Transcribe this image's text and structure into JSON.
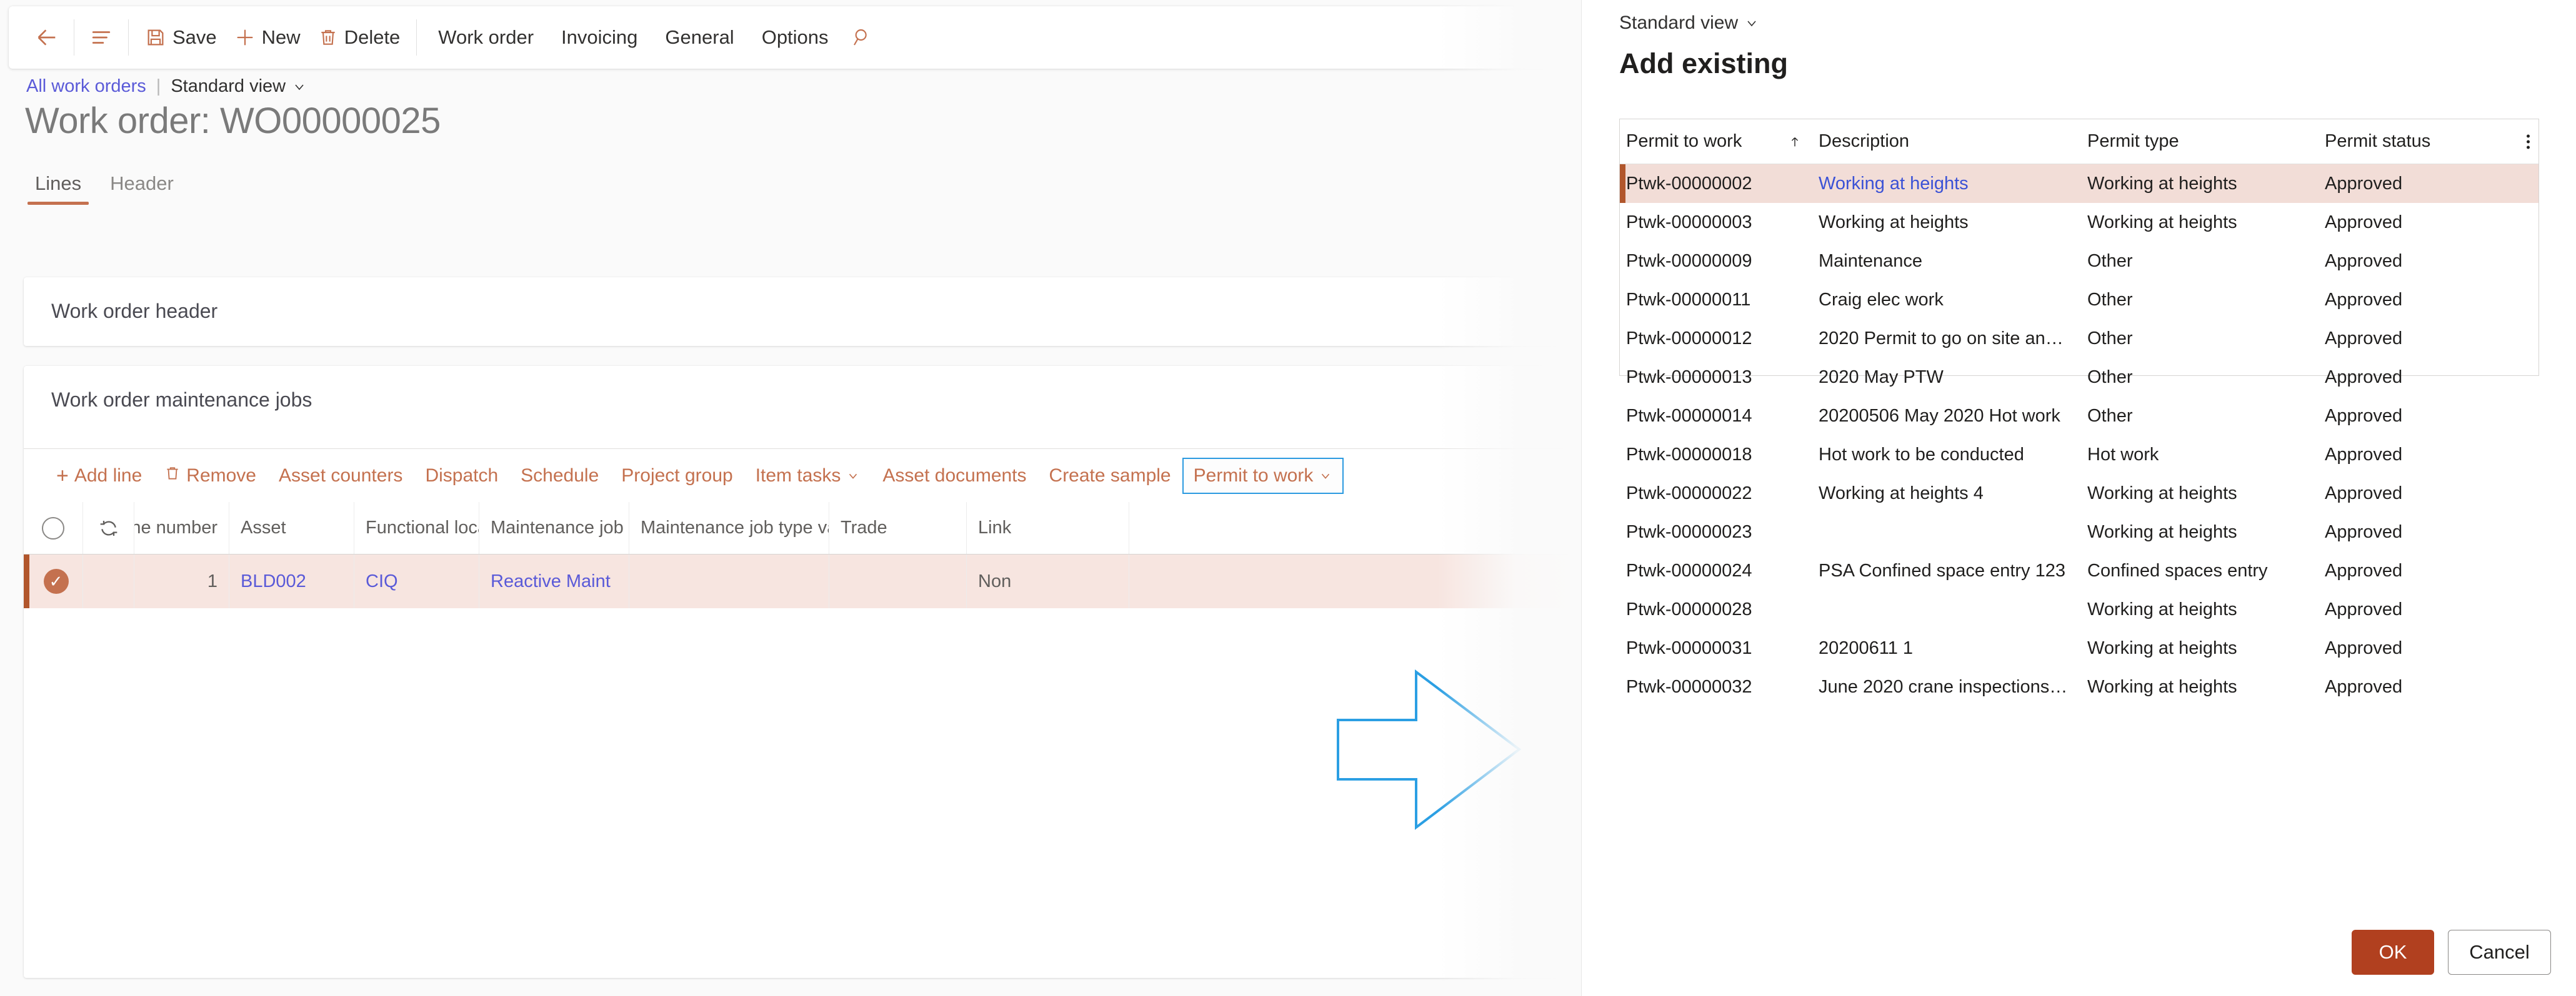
{
  "commandbar": {
    "back_icon": "back-arrow-icon",
    "menu_icon": "hamburger-menu-icon",
    "save_label": "Save",
    "new_label": "New",
    "delete_label": "Delete",
    "workorder_label": "Work order",
    "invoicing_label": "Invoicing",
    "general_label": "General",
    "options_label": "Options",
    "search_icon": "search-icon"
  },
  "breadcrumb": {
    "all_work_orders": "All work orders",
    "separator": "|",
    "view_selector": "Standard view"
  },
  "page": {
    "title": "Work order: WO00000025"
  },
  "tabs": [
    {
      "label": "Lines",
      "active": true
    },
    {
      "label": "Header",
      "active": false
    }
  ],
  "cards": {
    "work_order_header_title": "Work order header",
    "work_order_jobs_title": "Work order maintenance jobs"
  },
  "grid_toolbar": [
    {
      "label": "Add line",
      "icon": "plus-icon",
      "focused": false
    },
    {
      "label": "Remove",
      "icon": "trash-icon",
      "focused": false
    },
    {
      "label": "Asset counters",
      "icon": "",
      "focused": false
    },
    {
      "label": "Dispatch",
      "icon": "",
      "focused": false
    },
    {
      "label": "Schedule",
      "icon": "",
      "focused": false
    },
    {
      "label": "Project group",
      "icon": "",
      "focused": false
    },
    {
      "label": "Item tasks",
      "icon": "chevron-down-icon",
      "focused": false
    },
    {
      "label": "Asset documents",
      "icon": "",
      "focused": false
    },
    {
      "label": "Create sample",
      "icon": "",
      "focused": false
    },
    {
      "label": "Permit to work",
      "icon": "chevron-down-icon",
      "focused": true
    }
  ],
  "lines_grid": {
    "columns": [
      "Line number",
      "Asset",
      "Functional location",
      "Maintenance job type",
      "Maintenance job type variant",
      "Trade",
      "Link"
    ],
    "select_all_icon": "circle-select-all-icon",
    "refresh_icon": "refresh-icon",
    "rows": [
      {
        "selected": true,
        "check_icon": "check-circle-icon",
        "line_number": "1",
        "asset": "BLD002",
        "functional_location": "CIQ",
        "maintenance_job_type": "Reactive Maint",
        "maintenance_job_type_variant": "",
        "trade": "",
        "link": "Non"
      }
    ]
  },
  "annotation": {
    "arrow_icon": "right-arrow-annotation",
    "arrow_color": "#2B9FE3"
  },
  "dialog": {
    "view_selector": "Standard view",
    "title": "Add existing",
    "columns": {
      "permit_to_work": "Permit to work",
      "description": "Description",
      "permit_type": "Permit type",
      "permit_status": "Permit status",
      "sort_icon": "sort-ascending-icon",
      "kebab_icon": "more-options-icon"
    },
    "rows": [
      {
        "permit_to_work": "Ptwk-00000002",
        "description": "Working at heights",
        "permit_type": "Working at heights",
        "permit_status": "Approved",
        "selected": true
      },
      {
        "permit_to_work": "Ptwk-00000003",
        "description": "Working at heights",
        "permit_type": "Working at heights",
        "permit_status": "Approved",
        "selected": false
      },
      {
        "permit_to_work": "Ptwk-00000009",
        "description": "Maintenance",
        "permit_type": "Other",
        "permit_status": "Approved",
        "selected": false
      },
      {
        "permit_to_work": "Ptwk-00000011",
        "description": "Craig elec work",
        "permit_type": "Other",
        "permit_status": "Approved",
        "selected": false
      },
      {
        "permit_to_work": "Ptwk-00000012",
        "description": "2020 Permit to go on site an…",
        "permit_type": "Other",
        "permit_status": "Approved",
        "selected": false
      },
      {
        "permit_to_work": "Ptwk-00000013",
        "description": "2020 May PTW",
        "permit_type": "Other",
        "permit_status": "Approved",
        "selected": false
      },
      {
        "permit_to_work": "Ptwk-00000014",
        "description": "20200506 May 2020 Hot work",
        "permit_type": "Other",
        "permit_status": "Approved",
        "selected": false
      },
      {
        "permit_to_work": "Ptwk-00000018",
        "description": "Hot work to be conducted",
        "permit_type": "Hot work",
        "permit_status": "Approved",
        "selected": false
      },
      {
        "permit_to_work": "Ptwk-00000022",
        "description": "Working at heights 4",
        "permit_type": "Working at heights",
        "permit_status": "Approved",
        "selected": false
      },
      {
        "permit_to_work": "Ptwk-00000023",
        "description": "",
        "permit_type": "Working at heights",
        "permit_status": "Approved",
        "selected": false
      },
      {
        "permit_to_work": "Ptwk-00000024",
        "description": "PSA Confined space entry 123",
        "permit_type": "Confined spaces entry",
        "permit_status": "Approved",
        "selected": false
      },
      {
        "permit_to_work": "Ptwk-00000028",
        "description": "",
        "permit_type": "Working at heights",
        "permit_status": "Approved",
        "selected": false
      },
      {
        "permit_to_work": "Ptwk-00000031",
        "description": "20200611 1",
        "permit_type": "Working at heights",
        "permit_status": "Approved",
        "selected": false
      },
      {
        "permit_to_work": "Ptwk-00000032",
        "description": "June 2020 crane inspections…",
        "permit_type": "Working at heights",
        "permit_status": "Approved",
        "selected": false
      }
    ],
    "ok_label": "OK",
    "cancel_label": "Cancel"
  },
  "colors": {
    "accent": "#c4714f",
    "primary_button": "#b1401f",
    "selection_bar": "#b1562c",
    "selected_row": "#f2ddd7",
    "link": "#5a5ad8",
    "focus_blue": "#2b9ae0"
  }
}
